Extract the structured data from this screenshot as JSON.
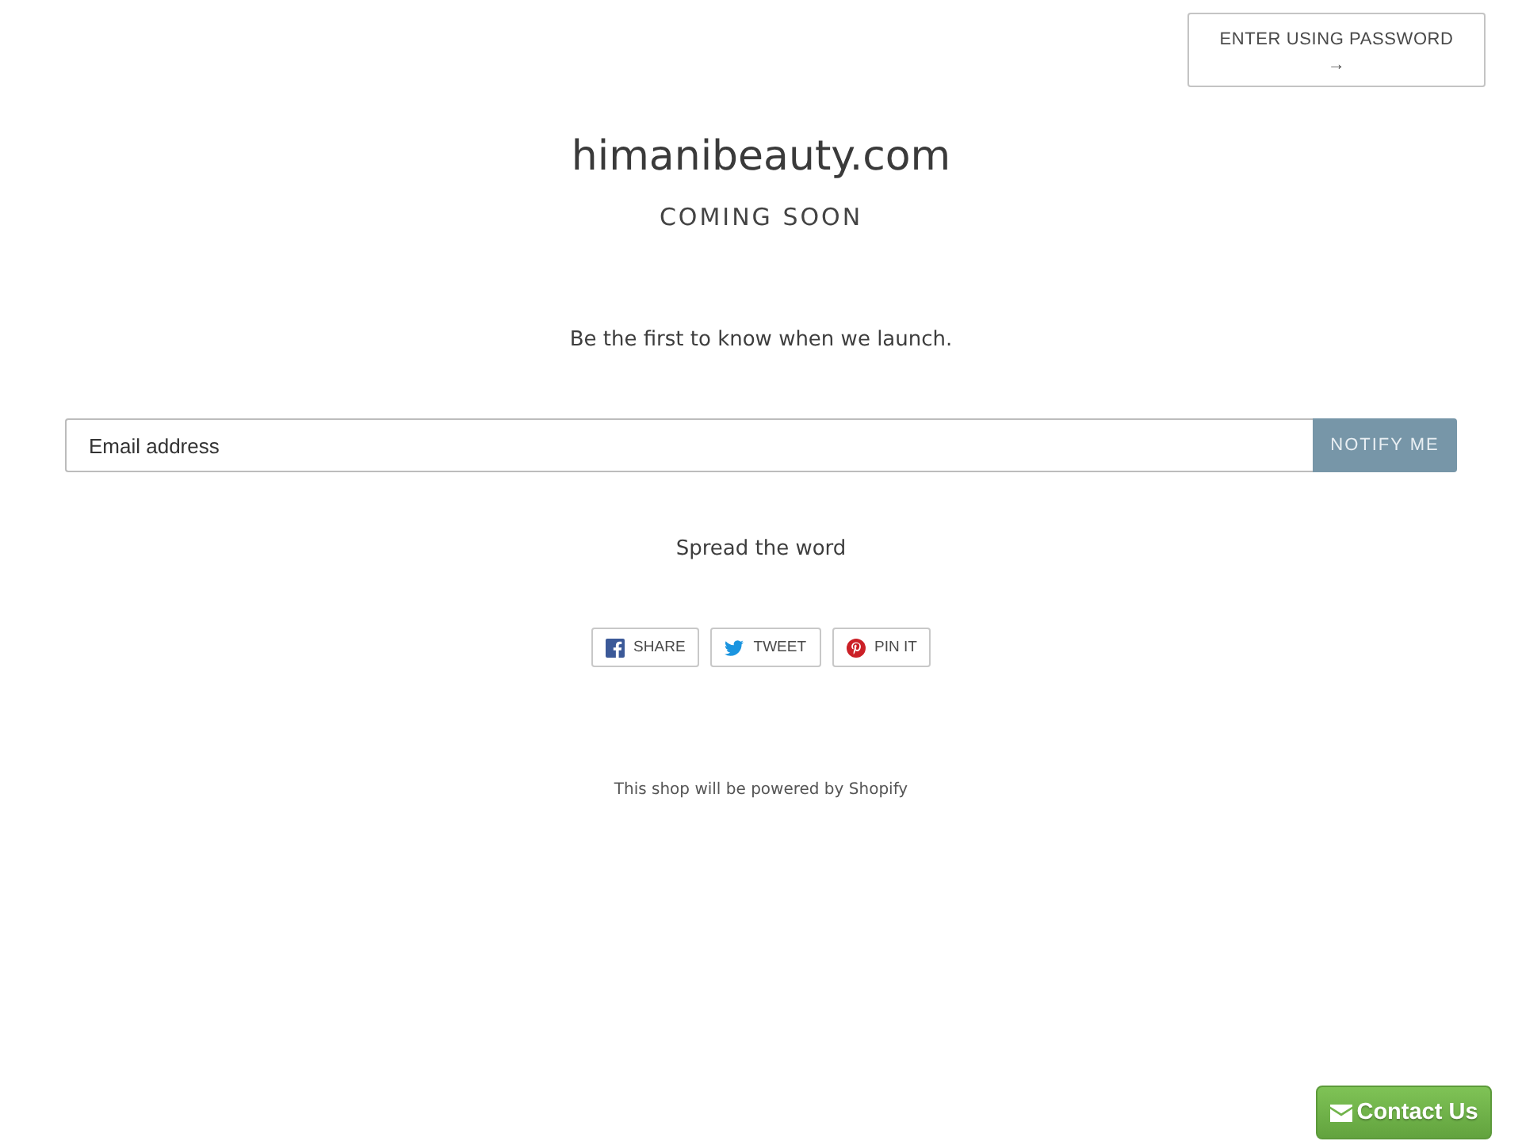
{
  "password_button": {
    "label": "ENTER USING PASSWORD",
    "arrow": "→"
  },
  "header": {
    "title": "himanibeauty.com",
    "subtitle": "COMING SOON"
  },
  "signup": {
    "tagline": "Be the first to know when we launch.",
    "email_field": {
      "placeholder": "Email address"
    },
    "submit": "NOTIFY ME"
  },
  "share": {
    "heading": "Spread the word",
    "buttons": [
      {
        "kind": "facebook",
        "label": "SHARE"
      },
      {
        "kind": "twitter",
        "label": "TWEET"
      },
      {
        "kind": "pinterest",
        "label": "PIN IT"
      }
    ]
  },
  "footer": {
    "text": "This shop will be powered by",
    "link": "Shopify"
  },
  "contact_button": {
    "label": "Contact Us"
  }
}
